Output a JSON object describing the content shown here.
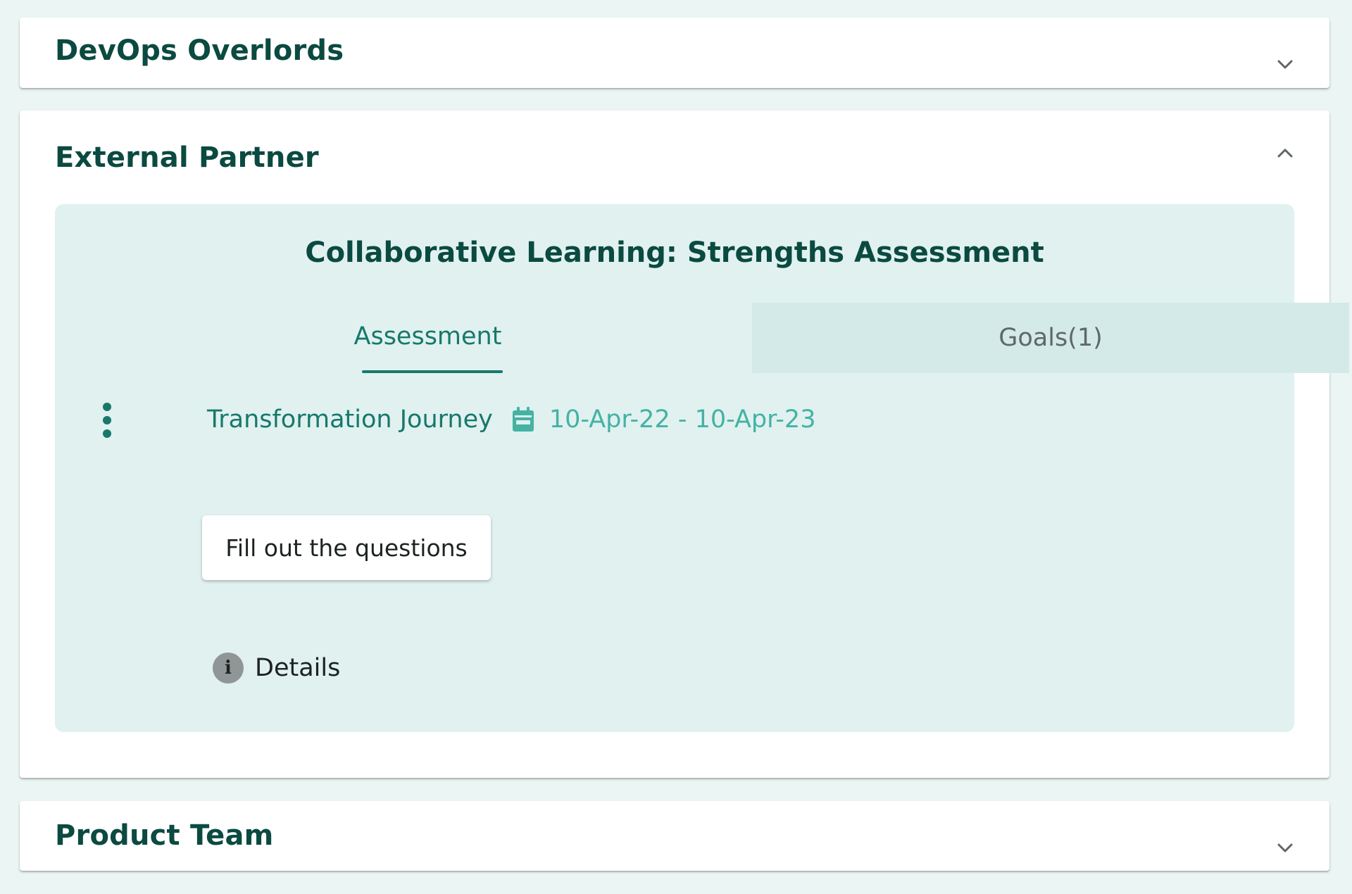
{
  "colors": {
    "page_background": "#ebf5f4",
    "panel_background": "#ffffff",
    "heading_text": "#0b4a40",
    "accent": "#17786b",
    "accent_light": "#45b2a4",
    "card_background": "#e0f1f0",
    "inactive_tab_background": "#d3eae8"
  },
  "panels": [
    {
      "title": "DevOps Overlords",
      "expanded": false,
      "toggle_icon": "chevron-down-icon"
    },
    {
      "title": "External Partner",
      "expanded": true,
      "toggle_icon": "chevron-up-icon",
      "card": {
        "title": "Collaborative Learning: Strengths Assessment",
        "tabs": [
          {
            "label": "Assessment",
            "active": true
          },
          {
            "label": "Goals(1)",
            "active": false
          }
        ],
        "menu_icon": "more-vertical-icon",
        "journey": {
          "name": "Transformation Journey",
          "date_icon": "calendar-icon",
          "dates": "10-Apr-22 - 10-Apr-23"
        },
        "action_button": "Fill out the questions",
        "details": {
          "icon": "info-icon",
          "icon_glyph": "i",
          "label": "Details"
        }
      }
    },
    {
      "title": "Product Team",
      "expanded": false,
      "toggle_icon": "chevron-down-icon"
    }
  ]
}
